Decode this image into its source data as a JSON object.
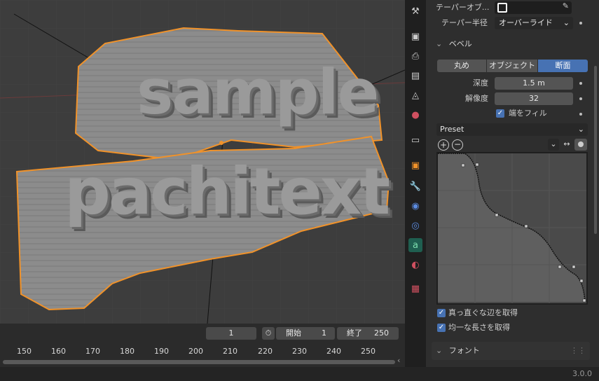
{
  "props": {
    "taper_object_label": "テーパーオブ...",
    "taper_radius_label": "テーパー半径",
    "taper_radius_value": "オーバーライド",
    "bevel_section": "ベベル",
    "bevel_modes": [
      "丸め",
      "オブジェクト",
      "断面"
    ],
    "depth_label": "深度",
    "depth_value": "1.5 m",
    "resolution_label": "解像度",
    "resolution_value": "32",
    "fill_caps_label": "端をフィル",
    "preset_label": "Preset",
    "straight_edges_label": "真っ直ぐな辺を取得",
    "even_length_label": "均一な長さを取得",
    "font_section": "フォント"
  },
  "viewport": {
    "text_line1": "sample",
    "text_line2": "pachitext"
  },
  "timeline": {
    "current_frame": "1",
    "start_label": "開始",
    "start_value": "1",
    "end_label": "終了",
    "end_value": "250",
    "ruler": [
      "150",
      "160",
      "170",
      "180",
      "190",
      "200",
      "210",
      "220",
      "230",
      "240",
      "250"
    ]
  },
  "status": {
    "version": "3.0.0"
  },
  "tabs": [
    "tool-icon",
    "render-icon",
    "output-icon",
    "view-layer-icon",
    "scene-icon",
    "world-icon",
    "collection-icon",
    "object-icon",
    "modifier-icon",
    "particles-icon",
    "physics-icon",
    "data-text-icon",
    "material-icon",
    "texture-icon"
  ],
  "colors": {
    "accent": "#4772b3",
    "selection_outline": "#f0922a",
    "active_tab": "#1f5f50"
  }
}
